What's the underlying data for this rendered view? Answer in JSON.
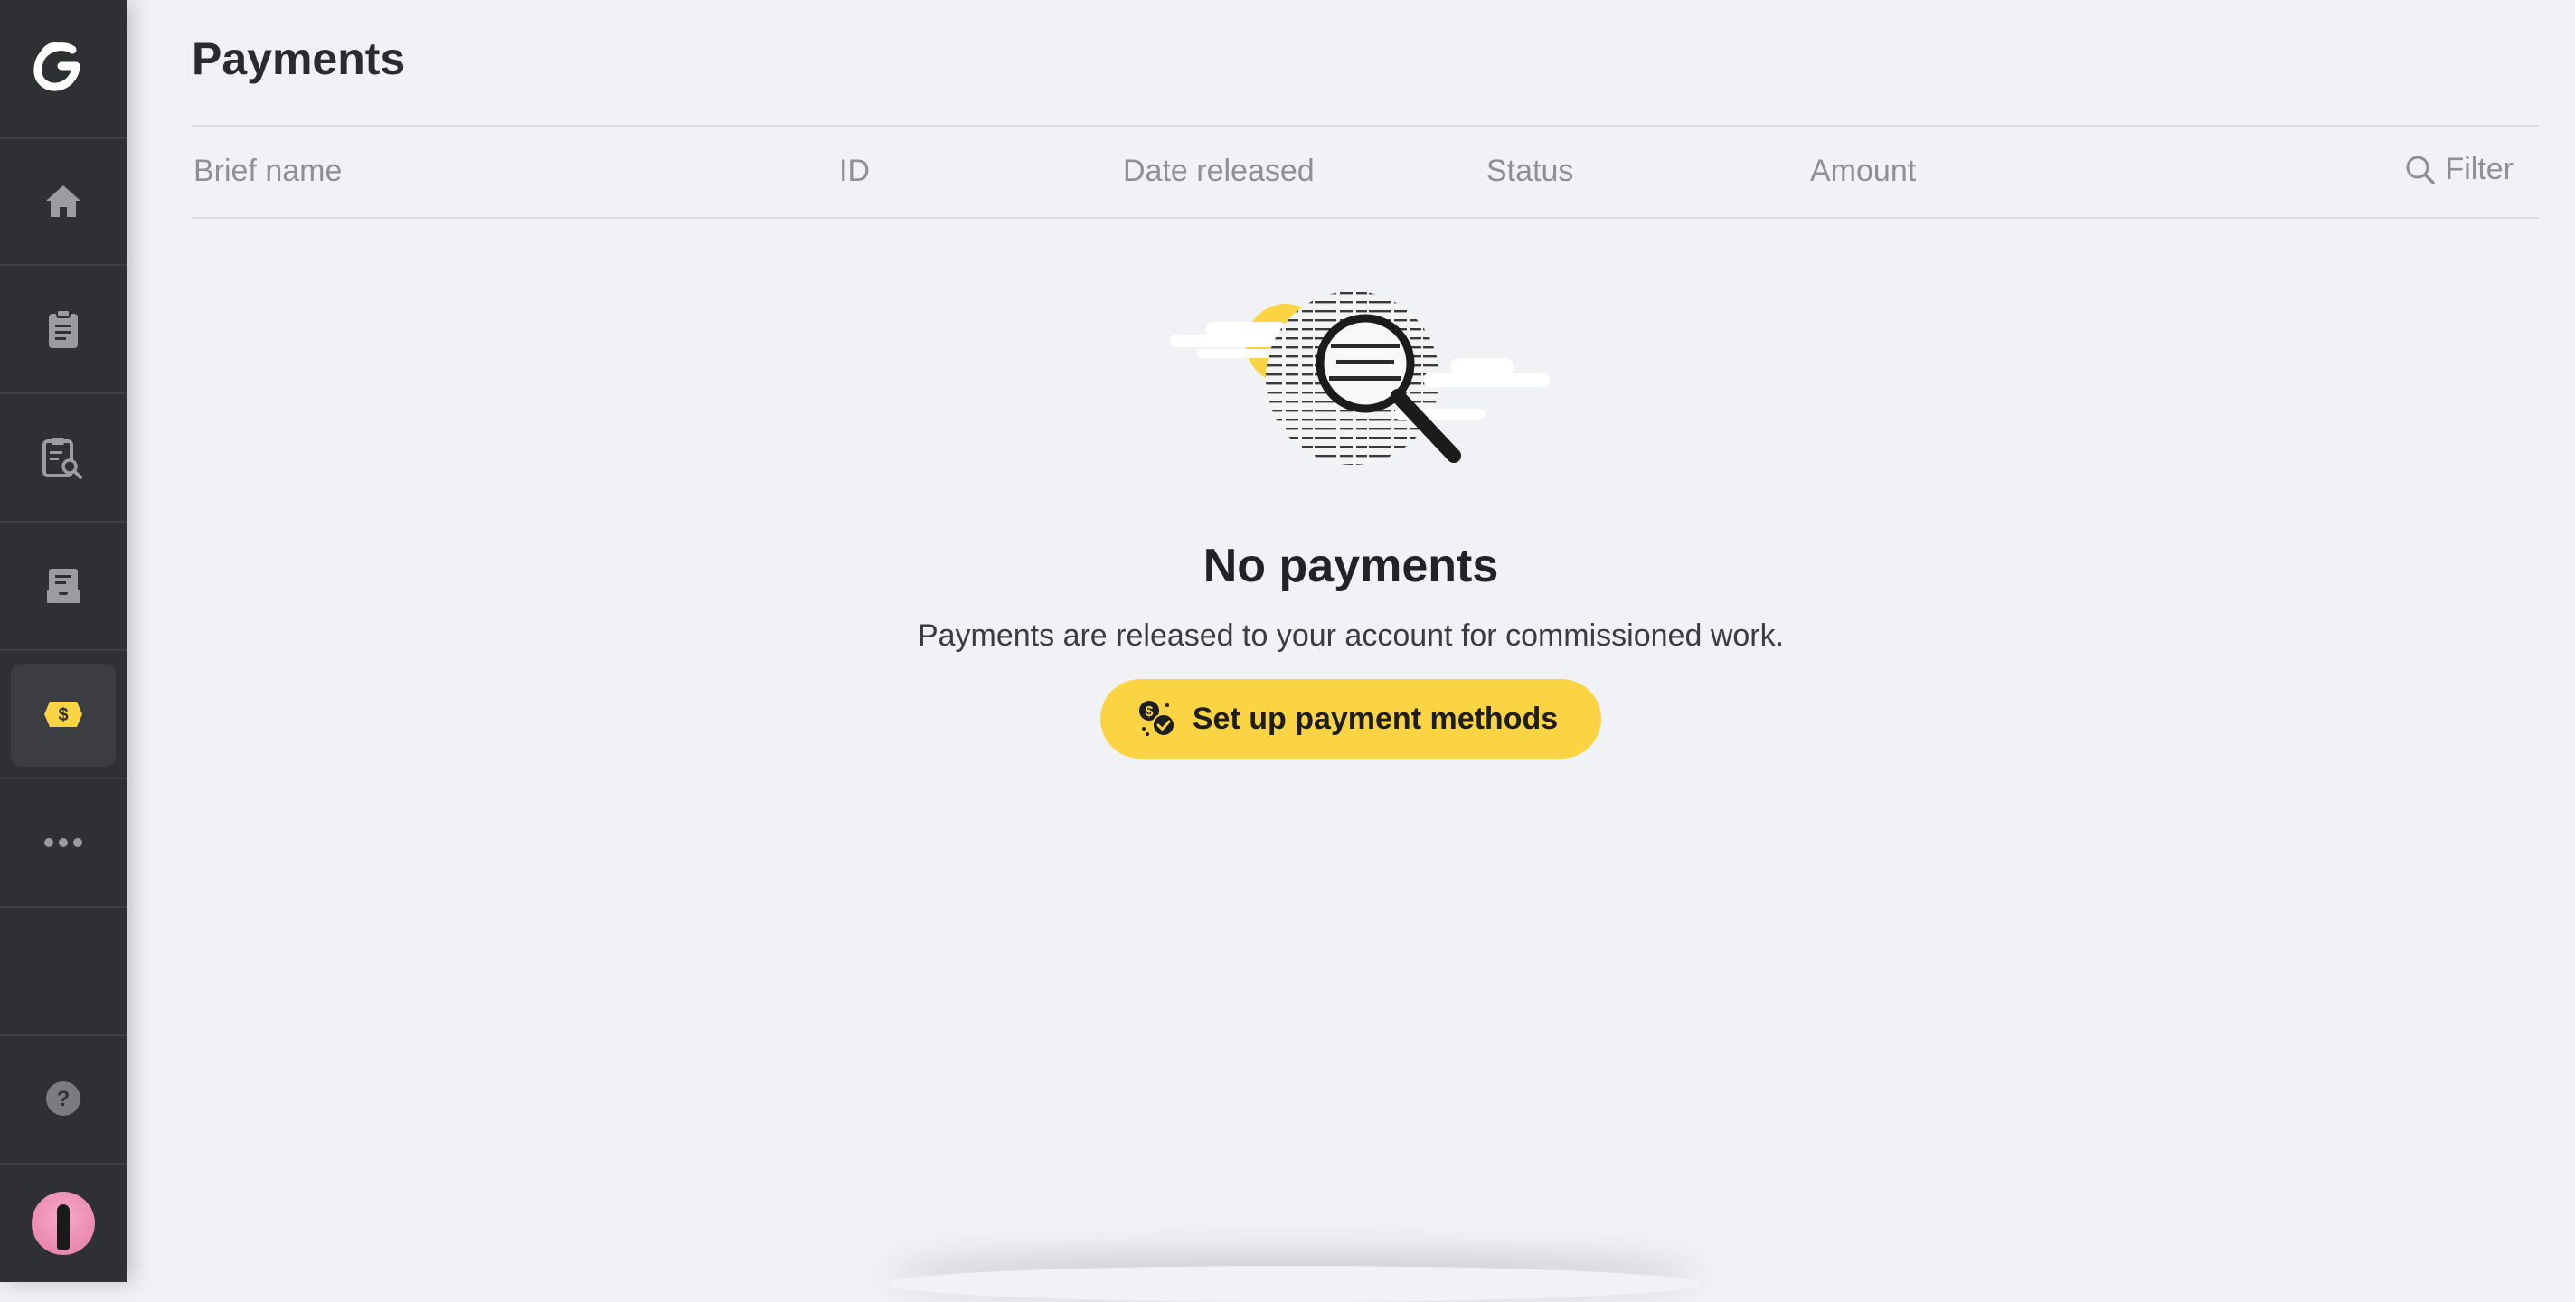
{
  "page": {
    "title": "Payments"
  },
  "table": {
    "columns": [
      {
        "label": "Brief name"
      },
      {
        "label": "ID"
      },
      {
        "label": "Date released"
      },
      {
        "label": "Status"
      },
      {
        "label": "Amount"
      }
    ],
    "filter_label": "Filter"
  },
  "empty_state": {
    "title": "No payments",
    "description": "Payments are released to your account for commissioned work.",
    "button_label": "Set up payment methods"
  },
  "sidebar": {
    "logo": "G",
    "items": [
      {
        "icon": "home-icon",
        "active": false
      },
      {
        "icon": "clipboard-icon",
        "active": false
      },
      {
        "icon": "clipboard-search-icon",
        "active": false
      },
      {
        "icon": "inbox-icon",
        "active": false
      },
      {
        "icon": "dollar-ticket-icon",
        "active": true
      },
      {
        "icon": "more-icon",
        "active": false
      }
    ],
    "help_icon": "help-icon",
    "avatar": "user-avatar"
  },
  "colors": {
    "sidebar_bg": "#2e3034",
    "page_bg": "#f1f2f6",
    "accent_yellow": "#fad443",
    "icon_gray": "#9a9ca1"
  }
}
